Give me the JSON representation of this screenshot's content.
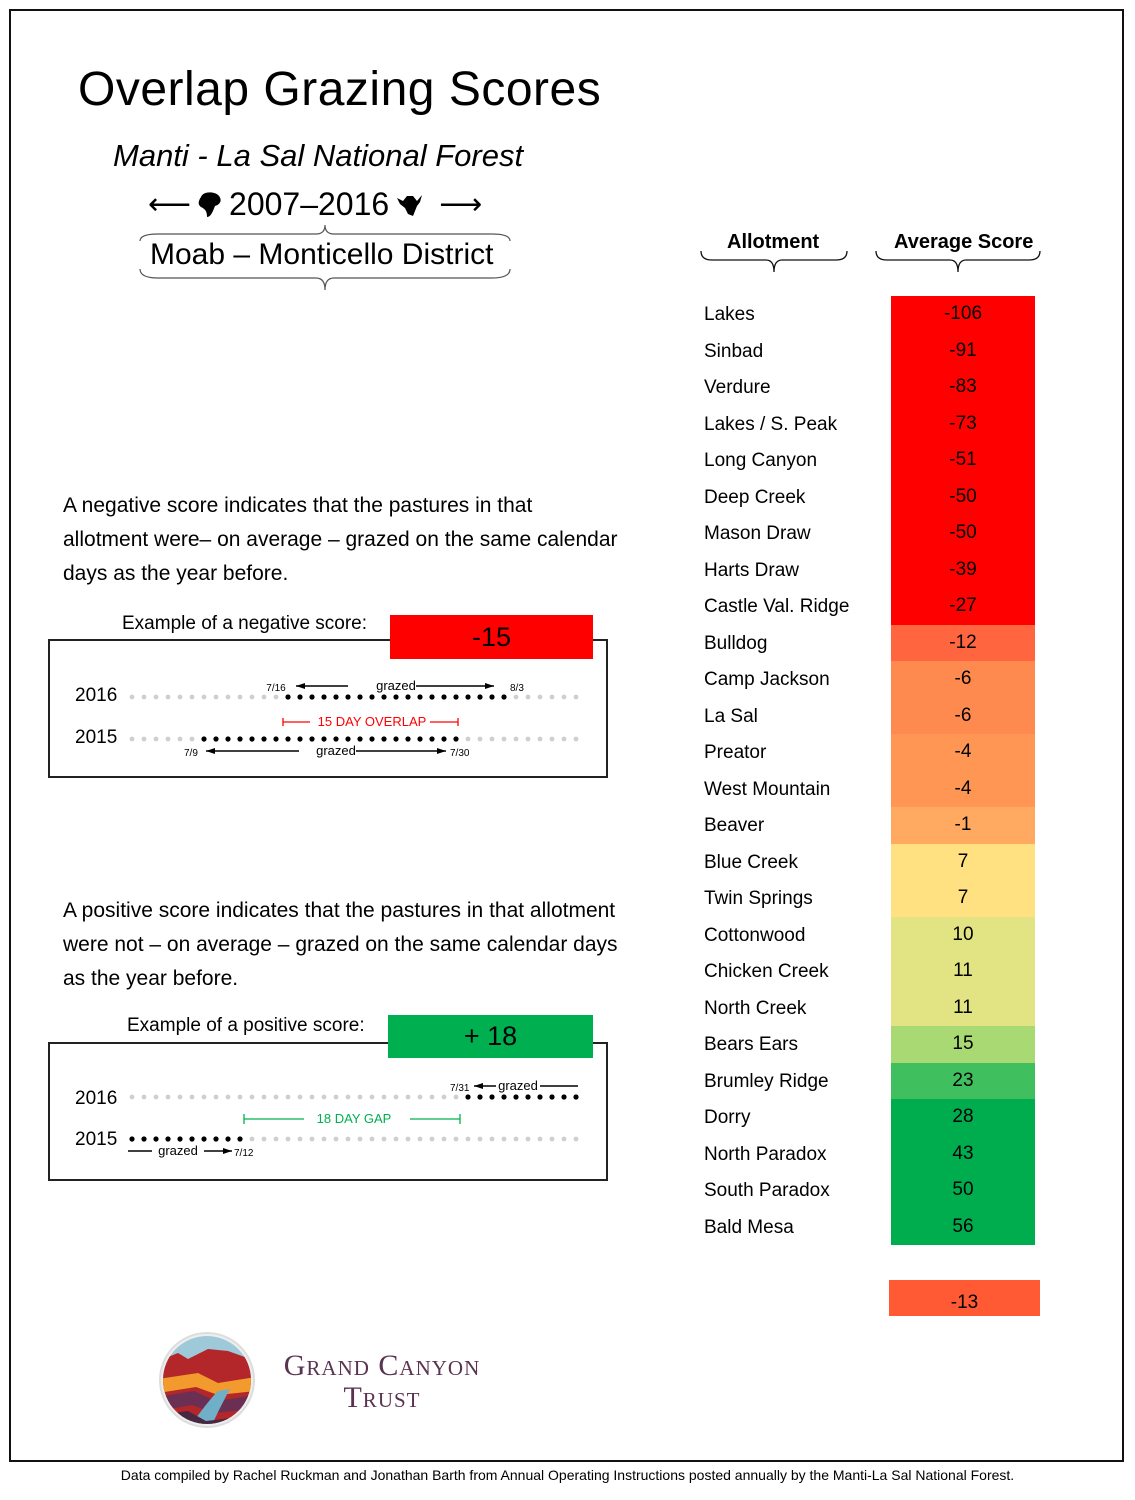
{
  "header": {
    "title": "Overlap Grazing Scores",
    "subtitle": "Manti - La Sal National Forest",
    "years": "2007–2016",
    "district": "Moab – Monticello District",
    "left_arrow": "⟵",
    "right_arrow": "⟶"
  },
  "explanations": {
    "negative_text": "A negative score indicates that the pastures in that allotment were– on average – grazed on the same calendar days as the year before.",
    "positive_text": "A positive score indicates that the pastures in that allotment were not – on average – grazed on the same calendar days as the year before."
  },
  "examples": {
    "negative": {
      "label": "Example of a negative score:",
      "score": "-15",
      "color": "#ff0000",
      "year_top": "2016",
      "year_bottom": "2015",
      "top_start": "7/16",
      "top_end": "8/3",
      "bottom_start": "7/9",
      "bottom_end": "7/30",
      "grazed": "grazed",
      "annotation": "15 DAY OVERLAP",
      "annotation_color": "#ff0000"
    },
    "positive": {
      "label": "Example of a positive score:",
      "score": "+ 18",
      "color": "#00b050",
      "year_top": "2016",
      "year_bottom": "2015",
      "top_start": "7/31",
      "bottom_end": "7/12",
      "grazed": "grazed",
      "annotation": "18 DAY GAP",
      "annotation_color": "#00b050"
    }
  },
  "table": {
    "col_allotment": "Allotment",
    "col_score": "Average Score",
    "average_value": "-13",
    "average_color": "#ff5a33"
  },
  "chart_data": {
    "type": "table",
    "title": "Overlap Grazing Scores",
    "columns": [
      "Allotment",
      "Average Score"
    ],
    "categories": [
      "Lakes",
      "Sinbad",
      "Verdure",
      "Lakes / S. Peak",
      "Long Canyon",
      "Deep Creek",
      "Mason Draw",
      "Harts Draw",
      "Castle Val. Ridge",
      "Bulldog",
      "Camp Jackson",
      "La Sal",
      "Preator",
      "West Mountain",
      "Beaver",
      "Blue Creek",
      "Twin Springs",
      "Cottonwood",
      "Chicken Creek",
      "North Creek",
      "Bears Ears",
      "Brumley Ridge",
      "Dorry",
      "North Paradox",
      "South Paradox",
      "Bald Mesa"
    ],
    "values": [
      -106,
      -91,
      -83,
      -73,
      -51,
      -50,
      -50,
      -39,
      -27,
      -12,
      -6,
      -6,
      -4,
      -4,
      -1,
      7,
      7,
      10,
      11,
      11,
      15,
      23,
      28,
      43,
      50,
      56
    ],
    "colors": [
      "#ff0000",
      "#ff0000",
      "#ff0000",
      "#ff0000",
      "#ff0000",
      "#ff0000",
      "#ff0000",
      "#ff0000",
      "#ff0000",
      "#ff6640",
      "#ff8a50",
      "#ff8a50",
      "#ff9654",
      "#ff9654",
      "#ffaa60",
      "#ffe182",
      "#ffe182",
      "#e2e382",
      "#e2e382",
      "#e2e382",
      "#a9d973",
      "#40bf5e",
      "#00ad4e",
      "#00ad4e",
      "#00ad4e",
      "#00ad4e"
    ],
    "summary_value": -13
  },
  "logo": {
    "line1": "Grand Canyon",
    "line2": "Trust"
  },
  "footer": "Data compiled by Rachel Ruckman and Jonathan Barth from Annual Operating Instructions posted annually by the Manti-La Sal National Forest."
}
